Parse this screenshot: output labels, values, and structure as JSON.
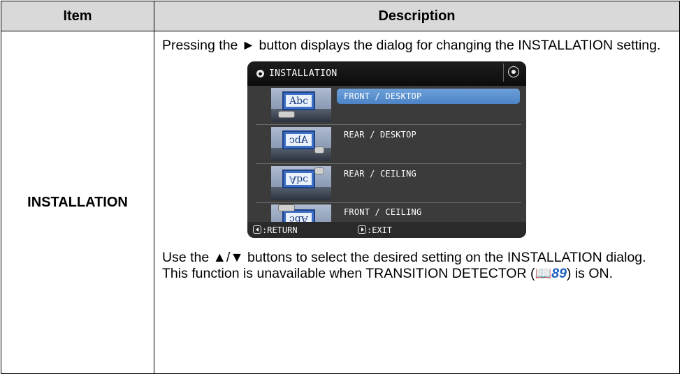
{
  "table": {
    "header": {
      "item": "Item",
      "description": "Description"
    },
    "row": {
      "item": "INSTALLATION",
      "desc_intro": "Pressing the ► button displays the dialog for changing the INSTALLATION setting.",
      "desc_select": "Use the ▲/▼ buttons to select the desired setting on the INSTALLATION dialog.",
      "desc_note_prefix": "This function is unavailable when TRANSITION DETECTOR (",
      "desc_note_icon": "book-icon",
      "desc_note_ref": "89",
      "desc_note_suffix": ") is ON."
    }
  },
  "dialog": {
    "title": "INSTALLATION",
    "options": [
      {
        "label": "FRONT / DESKTOP",
        "thumb_text": "Abc",
        "selected": true
      },
      {
        "label": "REAR / DESKTOP",
        "thumb_text": "Abc",
        "selected": false
      },
      {
        "label": "REAR / CEILING",
        "thumb_text": "Abc",
        "selected": false
      },
      {
        "label": "FRONT / CEILING",
        "thumb_text": "Abc",
        "selected": false
      }
    ],
    "footer": {
      "return_label": ":RETURN",
      "exit_label": ":EXIT"
    },
    "colors": {
      "background": "#3b3b3b",
      "selected": "#5a8fd0",
      "title_bar": "#141414"
    }
  }
}
